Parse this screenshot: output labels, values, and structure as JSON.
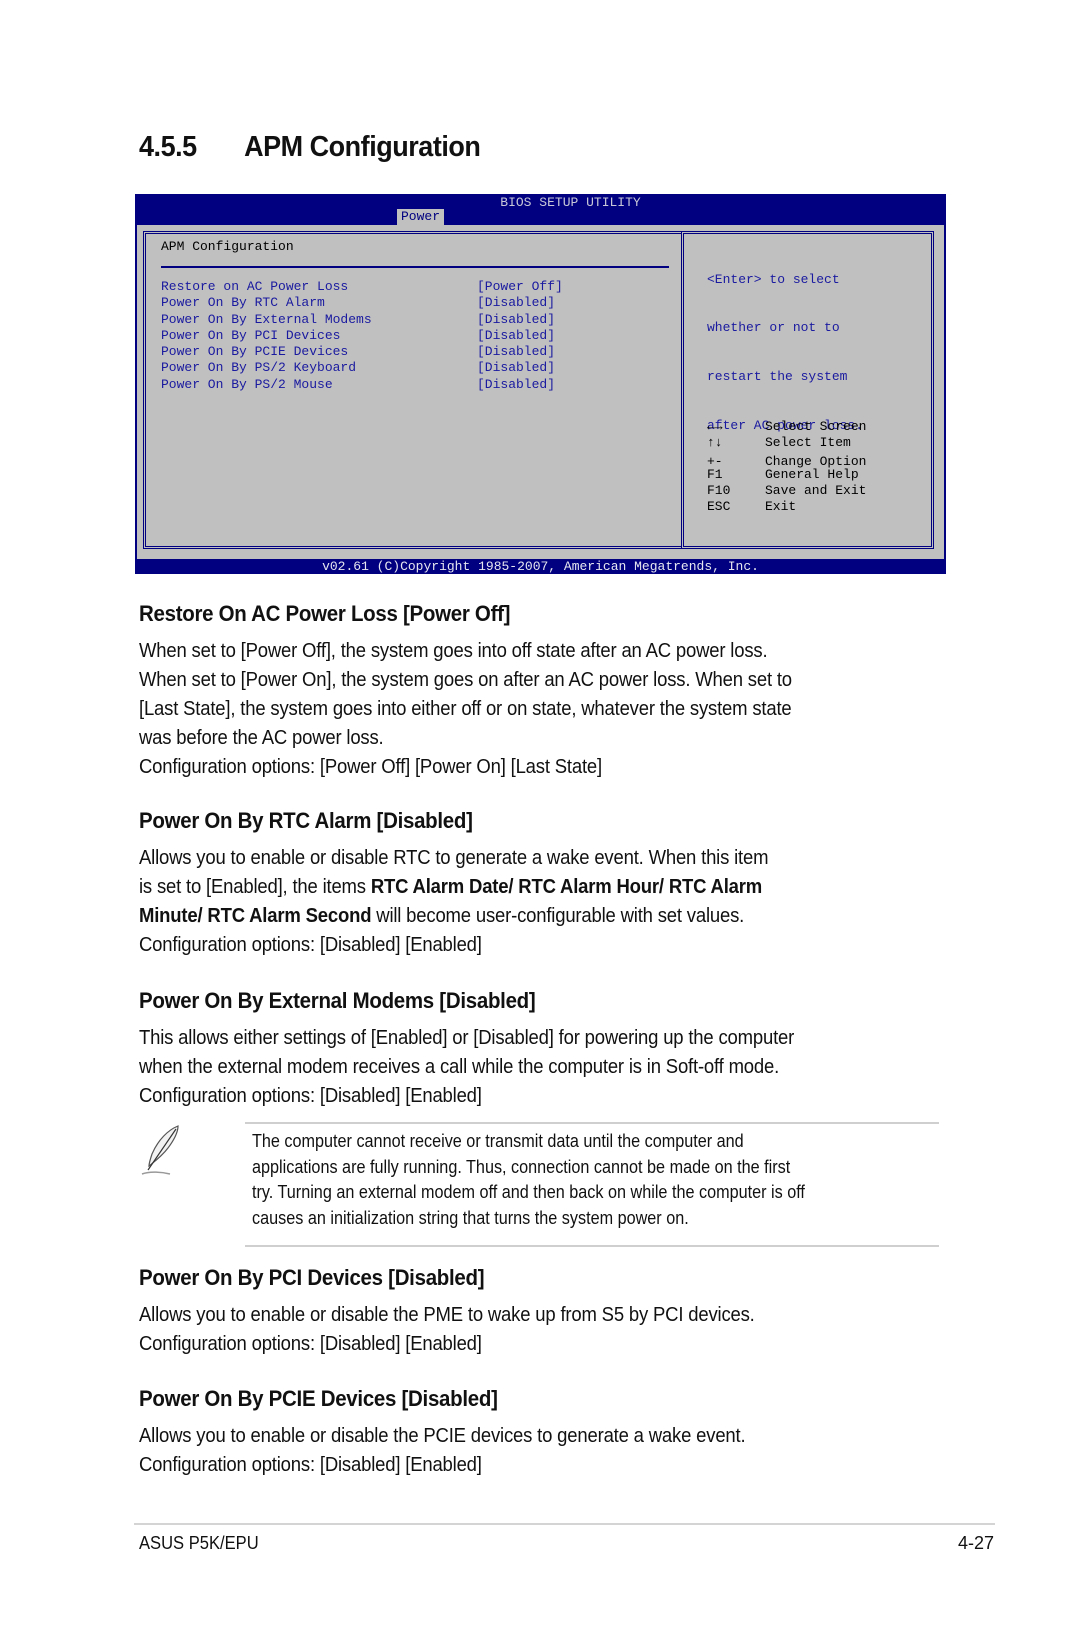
{
  "section": {
    "number": "4.5.5",
    "title": "APM Configuration"
  },
  "bios": {
    "title": "BIOS SETUP UTILITY",
    "active_tab": "Power",
    "panel_heading": "APM Configuration",
    "items": [
      {
        "label": "Restore on AC Power Loss",
        "value": "[Power Off]"
      },
      {
        "label": "Power On By RTC Alarm",
        "value": "[Disabled]"
      },
      {
        "label": "Power On By External Modems",
        "value": "[Disabled]"
      },
      {
        "label": "Power On By PCI Devices",
        "value": "[Disabled]"
      },
      {
        "label": "Power On By PCIE Devices",
        "value": "[Disabled]"
      },
      {
        "label": "Power On By PS/2 Keyboard",
        "value": "[Disabled]"
      },
      {
        "label": "Power On By PS/2 Mouse",
        "value": "[Disabled]"
      }
    ],
    "help_lines": [
      "<Enter> to select",
      "whether or not to",
      "restart the system",
      "after AC power loss."
    ],
    "keys": [
      {
        "key": "←→",
        "icon": "left-right-arrows-icon",
        "action": "Select Screen"
      },
      {
        "key": "↑↓",
        "icon": "up-down-arrows-icon",
        "action": "Select Item"
      },
      {
        "key": "+-",
        "action": "Change Option"
      },
      {
        "key": "F1",
        "action": "General Help"
      },
      {
        "key": "F10",
        "action": "Save and Exit"
      },
      {
        "key": "ESC",
        "action": "Exit"
      }
    ],
    "copyright": "v02.61 (C)Copyright 1985-2007, American Megatrends, Inc."
  },
  "sections": [
    {
      "heading": "Restore On AC Power Loss [Power Off]",
      "lines": [
        "When set to [Power Off], the system goes into off state after an AC power loss.",
        "When set to [Power On], the system goes on after an AC power loss. When set to",
        "[Last State], the system goes into either off or on state, whatever the system state",
        "was before the AC power loss."
      ],
      "options": "Configuration options: [Power Off] [Power On] [Last State]"
    },
    {
      "heading": "Power On By RTC Alarm [Disabled]",
      "line1": "Allows you to enable or disable RTC to generate a wake event. When this item",
      "line2_pre": "is set to [Enabled], the items ",
      "line2_bold": "RTC Alarm Date/ RTC Alarm Hour/ RTC Alarm",
      "line3_bold": "Minute/ RTC Alarm Second",
      "line3_post": " will become user-configurable with set values.",
      "options": "Configuration options: [Disabled] [Enabled]"
    },
    {
      "heading": "Power On By External Modems [Disabled]",
      "lines": [
        "This allows either settings of [Enabled] or [Disabled] for powering up the computer",
        "when the external modem receives a call while the computer is in Soft-off mode."
      ],
      "options": "Configuration options: [Disabled] [Enabled]",
      "note_icon": "feather-pen-icon",
      "note_lines": [
        "The computer cannot receive or transmit data until the computer and",
        "applications are fully running. Thus, connection cannot be made on the first",
        "try. Turning an external modem off and then back on while the computer is off",
        "causes an initialization string that turns the system power on."
      ]
    },
    {
      "heading": "Power On By PCI Devices [Disabled]",
      "lines": [
        "Allows you to enable or disable the PME to wake up from S5 by PCI devices."
      ],
      "options": "Configuration options: [Disabled] [Enabled]"
    },
    {
      "heading": "Power On By PCIE Devices [Disabled]",
      "lines": [
        "Allows you to enable or disable the PCIE devices to generate a wake event."
      ],
      "options": "Configuration options: [Disabled] [Enabled]"
    }
  ],
  "footer": {
    "product": "ASUS P5K/EPU",
    "page": "4-27"
  }
}
